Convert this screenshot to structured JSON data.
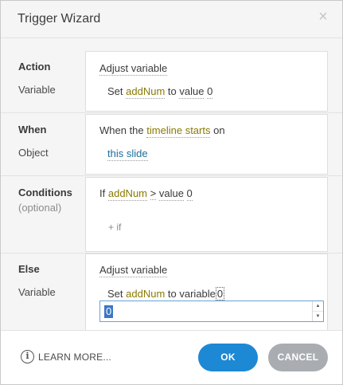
{
  "window": {
    "title": "Trigger Wizard",
    "close_glyph": "×"
  },
  "action": {
    "label": "Action",
    "sublabel": "Variable",
    "action_value": "Adjust variable",
    "line": {
      "set": "Set",
      "variable": "addNum",
      "to": "to",
      "value_kind": "value",
      "value": "0"
    }
  },
  "when": {
    "label": "When",
    "sublabel": "Object",
    "prefix": "When the",
    "event": "timeline starts",
    "suffix": "on",
    "object": "this slide"
  },
  "conditions": {
    "label": "Conditions",
    "sublabel": "(optional)",
    "if_word": "If",
    "variable": "addNum",
    "operator": ">",
    "value_kind": "value",
    "value": "0",
    "add_if": "+ if"
  },
  "else": {
    "label": "Else",
    "sublabel": "Variable",
    "action_value": "Adjust variable",
    "line": {
      "set": "Set",
      "variable": "addNum",
      "to": "to",
      "value_kind": "variable",
      "value": "0"
    },
    "input_value": "0"
  },
  "footer": {
    "learn_more": "LEARN MORE...",
    "info_icon": "info-icon",
    "ok_label": "OK",
    "cancel_label": "CANCEL"
  },
  "colors": {
    "ok_button": "#1d88d4",
    "cancel_button": "#a9adb1",
    "variable_text": "#8a7a00",
    "link_text": "#1d6e9c"
  }
}
